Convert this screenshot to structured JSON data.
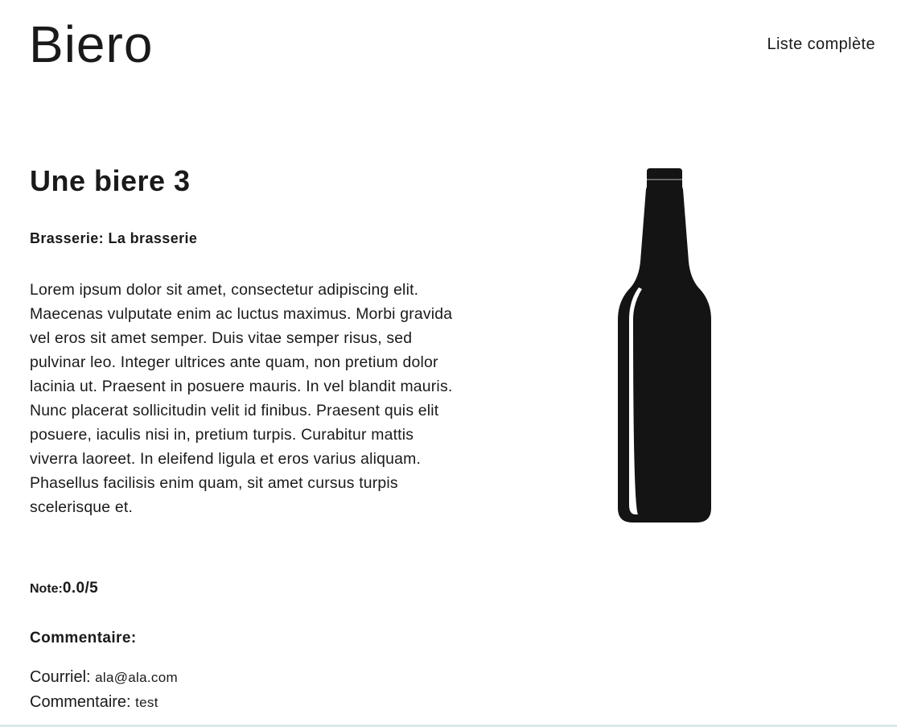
{
  "header": {
    "brand": "Biero",
    "nav_link": "Liste complète"
  },
  "beer": {
    "name": "Une biere 3",
    "brewery": "Brasserie: La brasserie",
    "description": "Lorem ipsum dolor sit amet, consectetur adipiscing elit. Maecenas vulputate enim ac luctus maximus. Morbi gravida vel eros sit amet semper. Duis vitae semper risus, sed pulvinar leo. Integer ultrices ante quam, non pretium dolor lacinia ut. Praesent in posuere mauris. In vel blandit mauris. Nunc placerat sollicitudin velit id finibus. Praesent quis elit posuere, iaculis nisi in, pretium turpis. Curabitur mattis viverra laoreet. In eleifend ligula et eros varius aliquam. Phasellus facilisis enim quam, sit amet cursus turpis scelerisque et.",
    "rating_label": "Note:",
    "rating_value": "0.0/5",
    "image_icon": "beer-bottle-icon"
  },
  "comments": {
    "heading": "Commentaire:",
    "items": [
      {
        "email_label": "Courriel: ",
        "email": "ala@ala.com",
        "text_label": "Commentaire: ",
        "text": "test"
      }
    ]
  },
  "colors": {
    "text": "#1a1a1a",
    "background": "#ffffff",
    "bottle": "#141414"
  }
}
